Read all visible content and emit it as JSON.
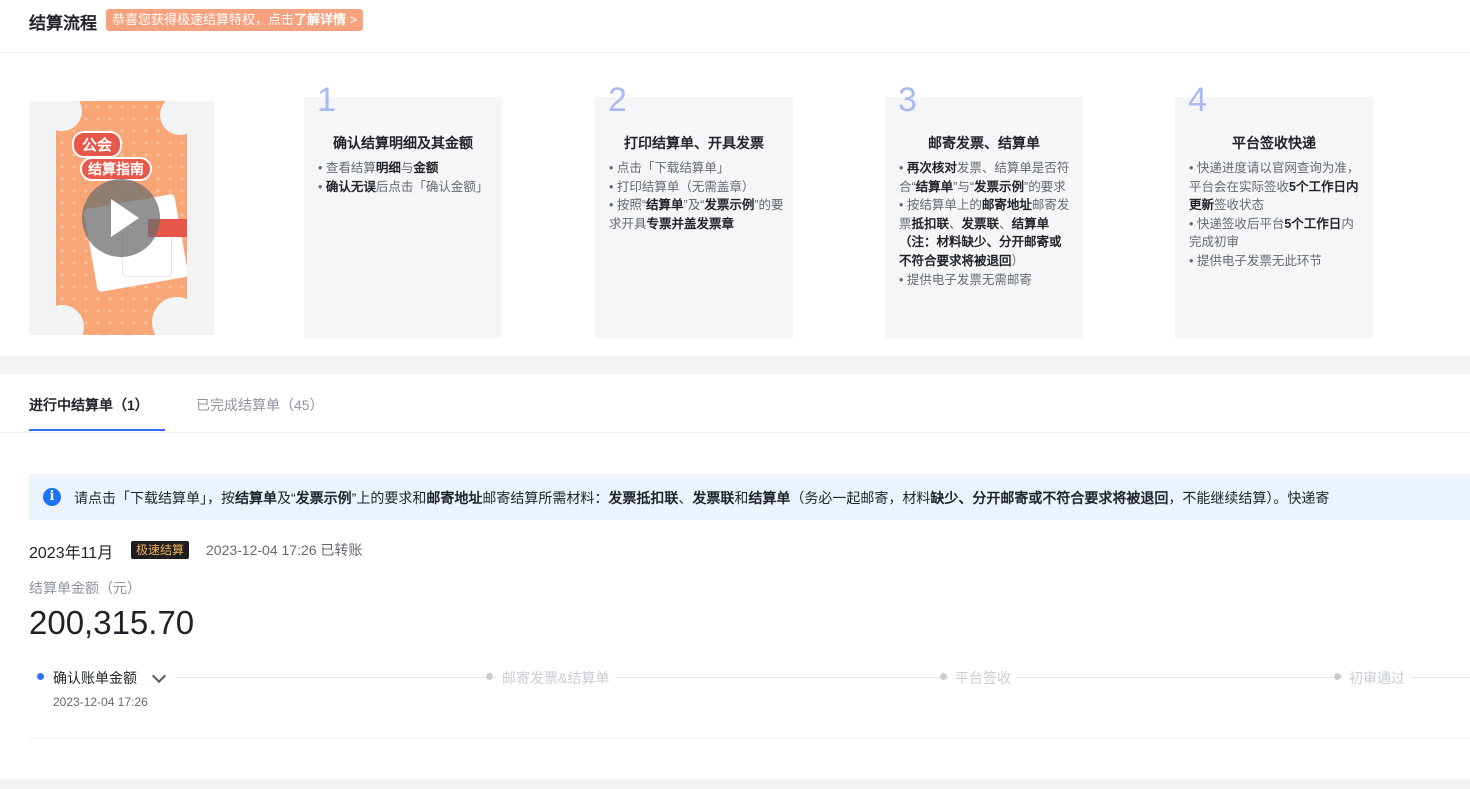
{
  "header": {
    "title": "结算流程",
    "promo_prefix": "恭喜您获得极速结算特权，点击",
    "promo_link": "了解详情",
    "promo_arrow": ">"
  },
  "video": {
    "tag1": "公会",
    "tag2": "结算指南"
  },
  "steps": [
    {
      "num": "1",
      "title": "确认结算明细及其金额",
      "lines": [
        [
          "• 查看结算",
          "明细",
          "与",
          "金额"
        ],
        [
          "• ",
          "确认无误",
          "后点击「确认金额」"
        ]
      ]
    },
    {
      "num": "2",
      "title": "打印结算单、开具发票",
      "lines": [
        [
          "• 点击「下载结算单」"
        ],
        [
          "• 打印结算单（无需盖章）"
        ],
        [
          "• 按照“",
          "结算单",
          "”及“",
          "发票示例",
          "”的要求开具",
          "专票并盖发票章"
        ]
      ]
    },
    {
      "num": "3",
      "title": "邮寄发票、结算单",
      "lines": [
        [
          "• ",
          "再次核对",
          "发票、结算单是否符合“",
          "结算单",
          "”与“",
          "发票示例",
          "”的要求"
        ],
        [
          "• 按结算单上的",
          "邮寄地址",
          "邮寄发票",
          "抵扣联",
          "、",
          "发票联",
          "、",
          "结算单",
          "（注：",
          "材料缺少、分开邮寄或不符合要求将被退回",
          "）"
        ],
        [
          "• 提供电子发票无需邮寄"
        ]
      ]
    },
    {
      "num": "4",
      "title": "平台签收快递",
      "lines": [
        [
          "• 快递进度请以官网查询为准，平台会在实际签收",
          "5个工作日内更新",
          "签收状态"
        ],
        [
          "• 快递签收后平台",
          "5个工作日",
          "内完成初审"
        ],
        [
          "• 提供电子发票无此环节"
        ]
      ]
    }
  ],
  "tabs": [
    {
      "label": "进行中结算单（1）",
      "active": true
    },
    {
      "label": "已完成结算单（45）",
      "active": false
    }
  ],
  "notice": {
    "icon": "info-icon",
    "parts": [
      [
        "请点击「下载结算单」，按",
        false
      ],
      [
        "结算单",
        true
      ],
      [
        "及“",
        false
      ],
      [
        "发票示例",
        true
      ],
      [
        "”上的要求和",
        false
      ],
      [
        "邮寄地址",
        true
      ],
      [
        "邮寄结算所需材料：",
        false
      ],
      [
        "发票抵扣联",
        true
      ],
      [
        "、",
        false
      ],
      [
        "发票联",
        true
      ],
      [
        "和",
        false
      ],
      [
        "结算单",
        true
      ],
      [
        "（务必一起邮寄，材料",
        false
      ],
      [
        "缺少、分开邮寄或不符合要求将被退回",
        true
      ],
      [
        "，不能继续结算）。快递寄",
        false
      ]
    ]
  },
  "statement": {
    "month": "2023年11月",
    "badge": "极速结算",
    "status": "2023-12-04 17:26 已转账",
    "amount_label": "结算单金额（元）",
    "amount": "200,315.70"
  },
  "progress": {
    "nodes": [
      {
        "label": "确认账单金额",
        "time": "2023-12-04 17:26",
        "active": true
      },
      {
        "label": "邮寄发票&结算单",
        "active": false
      },
      {
        "label": "平台签收",
        "active": false
      },
      {
        "label": "初审通过",
        "active": false
      }
    ]
  },
  "colors": {
    "accent": "#3370ff",
    "promo_bg": "#f7a27e",
    "notice_bg": "#ebf3fe",
    "step_num": "#a9b9f5",
    "badge_bg": "#1f1f1f",
    "badge_text": "#f0b15c"
  }
}
